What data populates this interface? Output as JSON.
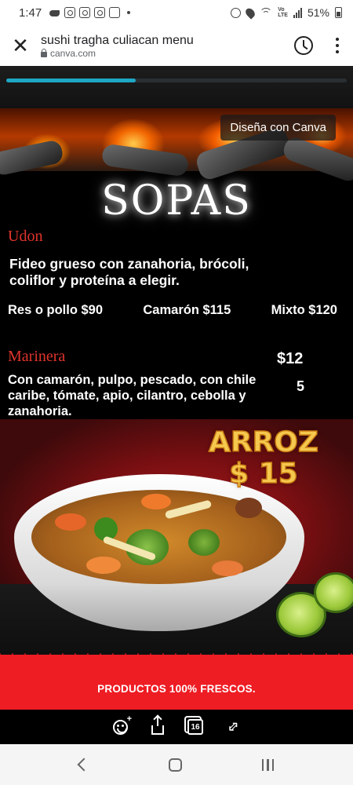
{
  "status_bar": {
    "time": "1:47",
    "battery": "51%"
  },
  "app_bar": {
    "title": "sushi tragha culiacan menu",
    "domain": "canva.com"
  },
  "presentation": {
    "progress_fraction": 0.38,
    "design_badge": "Diseña con Canva",
    "heading": "SOPAS",
    "udon": {
      "name": "Udon",
      "description_line1": "Fideo grueso con zanahoria, brócoli,",
      "description_line2": "coliflor y proteína a elegir.",
      "prices": [
        "Res o pollo $90",
        "Camarón  $115",
        "Mixto $120"
      ]
    },
    "marinera": {
      "name": "Marinera",
      "price_part1": "$12",
      "price_part2": "5",
      "description_line1": "Con camarón, pulpo, pescado, con chile",
      "description_line2": "caribe, tómate, apio, cilantro, cebolla y",
      "description_line3": "zanahoria."
    },
    "arroz": {
      "line1": "ARROZ",
      "line2": "$ 15"
    },
    "footer_text": "PRODUCTOS 100% FRESCOS.",
    "page_count": "16"
  },
  "icons": {
    "close": "close-icon",
    "history": "history-icon",
    "more": "more-vert-icon",
    "reaction": "emoji-add-icon",
    "share": "share-icon",
    "pages": "pages-icon",
    "fullscreen": "fullscreen-icon"
  },
  "colors": {
    "accent_progress": "#1ea7c4",
    "item_name_red": "#e0342b",
    "band_red": "#ee1d24",
    "arroz_gold": "#f5c84e"
  }
}
